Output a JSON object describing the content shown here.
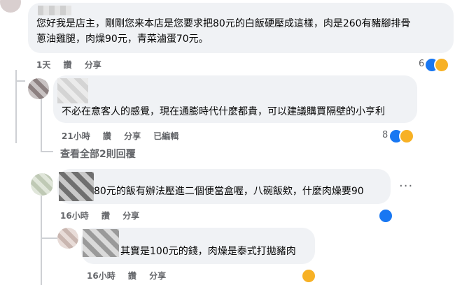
{
  "comments": [
    {
      "text_line1": "您好我是店主，剛剛您来本店是您要求把80元的白飯硬壓成這樣，肉是260有豬腳排骨",
      "text_line2": "蔥油雞腿，肉燥90元，青菜滷蛋70元。",
      "time": "1天",
      "like": "讚",
      "share": "分享",
      "reaction_count": "6"
    },
    {
      "text": "不必在意客人的感覺，現在通膨時代什麼都貴，可以建議購買隔壁的小亨利",
      "time": "21小時",
      "like": "讚",
      "share": "分享",
      "edited": "已編輯",
      "reaction_count": "8"
    },
    {
      "text": "80元的飯有辦法壓進二個便當盒喔，八碗飯欸，什麼肉燥要90",
      "time": "16小時",
      "like": "讚",
      "share": "分享"
    },
    {
      "text": "其實是100元的錢，肉燥是泰式打拋豬肉",
      "time": "16小時",
      "like": "讚",
      "share": "分享"
    }
  ],
  "view_all_replies": "查看全部2則回覆",
  "more_options": "···",
  "colors": {
    "bubble": "#f0f2f5",
    "meta": "#65676b",
    "like_blue": "#1877f2",
    "emoji_yellow": "#f7b125"
  },
  "icons": [
    "like-reaction-icon",
    "haha-reaction-icon",
    "wow-reaction-icon",
    "more-options-icon"
  ]
}
